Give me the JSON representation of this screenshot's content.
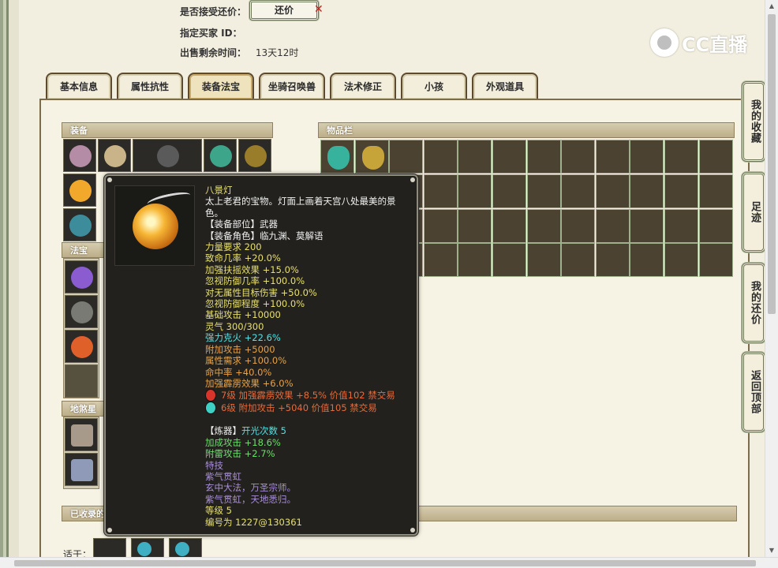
{
  "form": {
    "accept_counter_label": "是否接受还价：",
    "counter_button": "还价",
    "buyer_label": "指定买家 ID：",
    "remaining_label": "出售剩余时间：",
    "remaining_value": "13天12时"
  },
  "watermark": {
    "text": "CC直播"
  },
  "tabs": [
    {
      "label": "基本信息"
    },
    {
      "label": "属性抗性"
    },
    {
      "label": "装备法宝",
      "active": true
    },
    {
      "label": "坐骑召唤兽"
    },
    {
      "label": "法术修正"
    },
    {
      "label": "小孩"
    },
    {
      "label": "外观道具"
    }
  ],
  "sections": {
    "equipment": "装备",
    "inventory": "物品栏",
    "treasure": "法宝",
    "star": "地煞星",
    "collected": "已收录的",
    "applied": "适于："
  },
  "side_nav": [
    {
      "label": "我的收藏"
    },
    {
      "label": "足迹"
    },
    {
      "label": "我的还价"
    },
    {
      "label": "返回顶部"
    }
  ],
  "tooltip": {
    "name": "八景灯",
    "description": "太上老君的宝物。灯面上画着天宫八处最美的景色。",
    "slot": "【装备部位】武器",
    "roles": "【装备角色】临九渊、莫解语",
    "stats": [
      {
        "text": "力量要求 200",
        "color": "yellow"
      },
      {
        "text": "致命几率 +20.0%",
        "color": "yellow"
      },
      {
        "text": "加强扶摇效果 +15.0%",
        "color": "yellow"
      },
      {
        "text": "忽视防御几率 +100.0%",
        "color": "yellow"
      },
      {
        "text": "对无属性目标伤害 +50.0%",
        "color": "yellow"
      },
      {
        "text": "忽视防御程度 +100.0%",
        "color": "yellow"
      },
      {
        "text": "基础攻击 +10000",
        "color": "yellow"
      },
      {
        "text": "灵气 300/300",
        "color": "yellow"
      },
      {
        "text": "强力克火 +22.6%",
        "color": "cyan"
      },
      {
        "text": "附加攻击 +5000",
        "color": "orange"
      },
      {
        "text": "属性需求 +100.0%",
        "color": "orange"
      },
      {
        "text": "命中率 +40.0%",
        "color": "orange"
      },
      {
        "text": "加强霹雳效果 +6.0%",
        "color": "orange"
      }
    ],
    "gems": [
      {
        "text": "7级 加强霹雳效果 +8.5% 价值102 禁交易",
        "gem_color": "#d8342a"
      },
      {
        "text": "6级 附加攻击 +5040 价值105 禁交易",
        "gem_color": "#3fd0c4"
      }
    ],
    "refine_label": "【炼器】",
    "refine_value": "开光次数 5",
    "refine_stats": [
      {
        "text": "加成攻击 +18.6%",
        "color": "green"
      },
      {
        "text": "附雷攻击 +2.7%",
        "color": "green"
      }
    ],
    "skill_title": "特技",
    "skill_name": "紫气贯虹",
    "skill_lines": [
      "玄中大法，万圣宗师。",
      "紫气贯虹，天地悉归。"
    ],
    "level": "等级 5",
    "serial": "编号为 1227@130361"
  },
  "colors": {
    "yellow": "#e8e06a",
    "orange": "#e8a247",
    "cyan": "#58e0e2",
    "green": "#69e06a",
    "gem_text": "#e76a3a",
    "purple": "#a98fd8"
  }
}
